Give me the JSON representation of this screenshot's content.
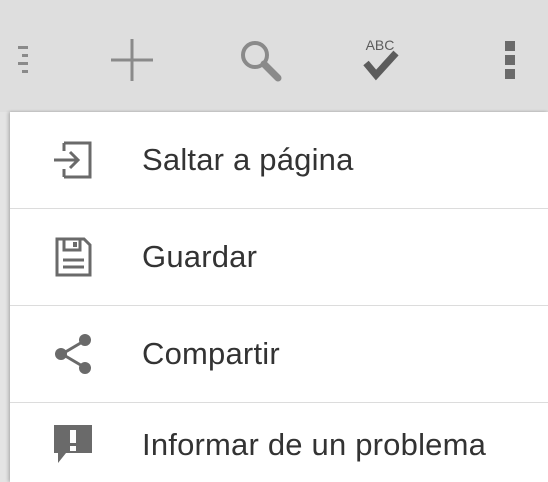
{
  "colors": {
    "toolbar_bg": "#dedede",
    "icon_gray": "#8a8a8a",
    "icon_dark": "#5c5c5c",
    "menu_text": "#333333",
    "divider": "#dcdcdc"
  },
  "toolbar": {
    "icons": [
      "list-outline-icon",
      "add-icon",
      "search-icon",
      "spellcheck-icon",
      "overflow-menu-icon"
    ],
    "spellcheck_text": "ABC"
  },
  "menu": {
    "items": [
      {
        "label": "Saltar a página",
        "icon": "jump-to-page-icon"
      },
      {
        "label": "Guardar",
        "icon": "save-icon"
      },
      {
        "label": "Compartir",
        "icon": "share-icon"
      },
      {
        "label": "Informar de un problema",
        "icon": "report-problem-icon"
      }
    ]
  }
}
